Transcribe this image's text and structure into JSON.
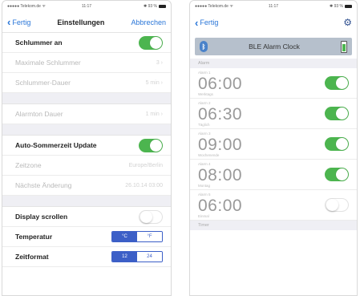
{
  "left": {
    "status": {
      "carrier": "●●●●● Telekom.de ᯤ",
      "time": "11:17",
      "battery": "✱ 93 %"
    },
    "nav": {
      "back": "Fertig",
      "title": "Einstellungen",
      "action": "Abbrechen"
    },
    "rows": [
      {
        "label": "Schlummer an",
        "toggle": "on"
      },
      {
        "label": "Maximale Schlummer",
        "value": "3 ›",
        "dim": true
      },
      {
        "label": "Schlummer-Dauer",
        "value": "5 min ›",
        "dim": true
      },
      {
        "label": "Alarmton Dauer",
        "value": "1 min ›",
        "dim": true
      },
      {
        "label": "Auto-Sommerzeit Update",
        "toggle": "on"
      },
      {
        "label": "Zeitzone",
        "value": "Europe/Berlin",
        "dim": true
      },
      {
        "label": "Nächste Änderung",
        "value": "26.10.14 03:00",
        "dim": true
      },
      {
        "label": "Display scrollen",
        "toggle": "off"
      },
      {
        "label": "Temperatur",
        "segments": [
          "°C",
          "°F"
        ],
        "selected": 0
      },
      {
        "label": "Zeitformat",
        "segments": [
          "12",
          "24"
        ],
        "selected": 0
      }
    ]
  },
  "right": {
    "status": {
      "carrier": "●●●●● Telekom.de ᯤ",
      "time": "11:17",
      "battery": "✱ 93 %"
    },
    "nav": {
      "back": "Fertig",
      "icon": "gear-icon"
    },
    "device": {
      "name": "BLE Alarm Clock",
      "icon": "bluetooth-icon"
    },
    "section_alarm": "Alarm",
    "alarms": [
      {
        "label": "Alarm 1",
        "time": "06:00",
        "sub": "Werktags",
        "enabled": true
      },
      {
        "label": "Alarm 2",
        "time": "06:30",
        "sub": "Täglich",
        "enabled": true
      },
      {
        "label": "Alarm 3",
        "time": "09:00",
        "sub": "Wochenende",
        "enabled": true
      },
      {
        "label": "Alarm 4",
        "time": "08:00",
        "sub": "Montag",
        "enabled": true
      },
      {
        "label": "Alarm 5",
        "time": "06:00",
        "sub": "Einmal",
        "enabled": false
      }
    ],
    "section_timer": "Timer"
  },
  "colors": {
    "accent": "#2a76d8",
    "toggle_on": "#4cb54f",
    "segment": "#3c5fc7"
  }
}
